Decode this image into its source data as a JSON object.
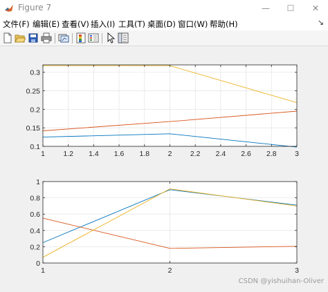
{
  "window": {
    "title": "Figure 7",
    "minimize_glyph": "—",
    "maximize_glyph": "☐",
    "close_glyph": "✕"
  },
  "menu": {
    "items": [
      "文件(F)",
      "编辑(E)",
      "查看(V)",
      "插入(I)",
      "工具(T)",
      "桌面(D)",
      "窗口(W)",
      "帮助(H)"
    ],
    "overflow_glyph": "↘"
  },
  "toolbar": {
    "icons": [
      "new-figure-icon",
      "open-file-icon",
      "save-icon",
      "print-icon",
      "link-plot-icon",
      "colorbar-icon",
      "legend-icon",
      "edit-plot-arrow-icon",
      "property-inspector-icon"
    ]
  },
  "watermark": "CSDN @yishuihan-Oliver",
  "colors": {
    "series1": "#0072BD",
    "series2": "#D95319",
    "series3": "#EDB120",
    "axes_bg": "#ffffff",
    "figure_bg": "#f0f0f0"
  },
  "chart_data": [
    {
      "type": "line",
      "title": "",
      "xlabel": "",
      "ylabel": "",
      "xlim": [
        1,
        3
      ],
      "ylim": [
        0.1,
        0.32
      ],
      "xticks": [
        "1",
        "1.2",
        "1.4",
        "1.6",
        "1.8",
        "2",
        "2.2",
        "2.4",
        "2.6",
        "2.8",
        "3"
      ],
      "xtick_values": [
        1,
        1.2,
        1.4,
        1.6,
        1.8,
        2,
        2.2,
        2.4,
        2.6,
        2.8,
        3
      ],
      "yticks": [
        "0.1",
        "0.15",
        "0.2",
        "0.25",
        "0.3"
      ],
      "ytick_values": [
        0.1,
        0.15,
        0.2,
        0.25,
        0.3
      ],
      "grid": true,
      "x": [
        1,
        2,
        3
      ],
      "series": [
        {
          "values": [
            0.125,
            0.134,
            0.098
          ],
          "color": "#0072BD"
        },
        {
          "values": [
            0.142,
            0.167,
            0.195
          ],
          "color": "#D95319"
        },
        {
          "values": [
            0.318,
            0.318,
            0.218
          ],
          "color": "#EDB120"
        }
      ]
    },
    {
      "type": "line",
      "title": "",
      "xlabel": "",
      "ylabel": "",
      "xlim": [
        1,
        3
      ],
      "ylim": [
        0,
        1
      ],
      "xticks": [
        "1",
        "2",
        "3"
      ],
      "xtick_values": [
        1,
        2,
        3
      ],
      "yticks": [
        "0",
        "0.2",
        "0.4",
        "0.6",
        "0.8",
        "1"
      ],
      "ytick_values": [
        0,
        0.2,
        0.4,
        0.6,
        0.8,
        1
      ],
      "grid": true,
      "x": [
        1,
        2,
        3
      ],
      "series": [
        {
          "values": [
            0.25,
            0.9,
            0.71
          ],
          "color": "#0072BD"
        },
        {
          "values": [
            0.55,
            0.18,
            0.205
          ],
          "color": "#D95319"
        },
        {
          "values": [
            0.07,
            0.91,
            0.7
          ],
          "color": "#EDB120"
        }
      ]
    }
  ]
}
